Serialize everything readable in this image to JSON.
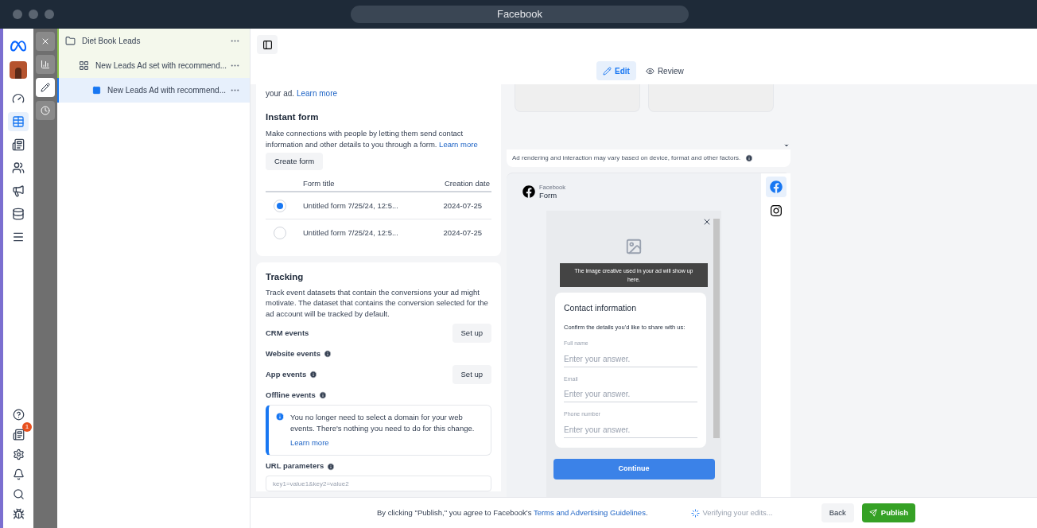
{
  "window": {
    "title": "Facebook"
  },
  "rail": {
    "items": [
      {
        "selected": false
      },
      {
        "selected": true
      },
      {
        "selected": false
      },
      {
        "selected": false
      },
      {
        "selected": false
      },
      {
        "selected": false
      },
      {
        "selected": false
      }
    ],
    "news_badge": "1"
  },
  "tool_strip": [
    {
      "selected": false
    },
    {
      "selected": false
    },
    {
      "selected": true
    },
    {
      "selected": false
    }
  ],
  "tree": [
    {
      "label": "Diet Book Leads",
      "kind": "campaign",
      "selected": false,
      "children": [
        {
          "label": "New Leads Ad set with recommend...",
          "kind": "adset",
          "selected": false,
          "children": [
            {
              "label": "New Leads Ad with recommend...",
              "kind": "ad",
              "selected": true
            }
          ]
        }
      ]
    }
  ],
  "tabs": [
    {
      "label": "Edit",
      "selected": true
    },
    {
      "label": "Review",
      "selected": false
    }
  ],
  "destination": {
    "text": "your ad.",
    "link": "Learn more"
  },
  "instant_form": {
    "title": "Instant form",
    "description": "Make connections with people by letting them send contact information and other details to you through a form.",
    "link": "Learn more",
    "button": "Create form",
    "columns": [
      "Form title",
      "Creation date"
    ],
    "rows": [
      {
        "title": "Untitled form 7/25/24, 12:5...",
        "date": "2024-07-25",
        "selected": true
      },
      {
        "title": "Untitled form 7/25/24, 12:5...",
        "date": "2024-07-25",
        "selected": false
      }
    ]
  },
  "tracking": {
    "title": "Tracking",
    "description": "Track event datasets that contain the conversions your ad might motivate. The dataset that contains the conversion selected for the ad account will be tracked by default.",
    "events": [
      {
        "label": "CRM events",
        "info": false,
        "button": "Set up"
      },
      {
        "label": "Website events",
        "info": true
      },
      {
        "label": "App events",
        "info": true,
        "button": "Set up"
      },
      {
        "label": "Offline events",
        "info": true
      }
    ],
    "notice": {
      "text": "You no longer need to select a domain for your web events. There's nothing you need to do for this change.",
      "link": "Learn more"
    },
    "url_parameters": {
      "label": "URL parameters",
      "placeholder": "key1=value1&key2=value2"
    }
  },
  "preview": {
    "note": "Ad rendering and interaction may vary based on device, format and other factors.",
    "platform": "Facebook",
    "placement": "Form",
    "platforms": [
      {
        "selected": true
      },
      {
        "selected": false
      }
    ],
    "banner": "The image creative used in your ad will show up here.",
    "card_title": "Contact information",
    "card_subtitle": "Confirm the details you'd like to share with us:",
    "fields": [
      {
        "label": "Full name",
        "placeholder": "Enter your answer."
      },
      {
        "label": "Email",
        "placeholder": "Enter your answer."
      },
      {
        "label": "Phone number",
        "placeholder": "Enter your answer."
      }
    ],
    "button": "Continue"
  },
  "footer": {
    "text_before": "By clicking \"Publish,\" you agree to Facebook's",
    "link": "Terms and Advertising Guidelines",
    "text_after": ".",
    "status": "Verifying your edits...",
    "back": "Back",
    "publish": "Publish"
  }
}
